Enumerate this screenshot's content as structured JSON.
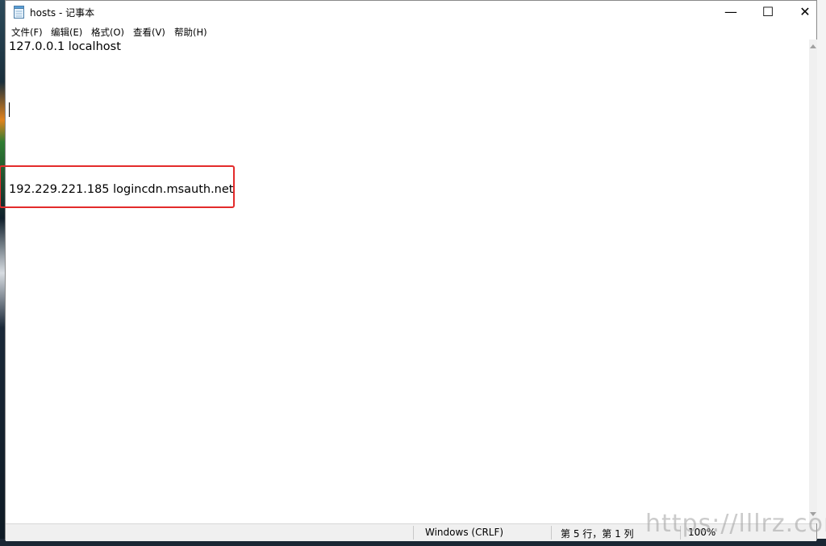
{
  "window": {
    "title": "hosts - 记事本",
    "minimize_glyph": "—",
    "maximize_glyph": "☐",
    "close_glyph": "✕"
  },
  "menu": {
    "items": [
      "文件(F)",
      "编辑(E)",
      "格式(O)",
      "查看(V)",
      "帮助(H)"
    ]
  },
  "editor": {
    "lines": [
      "127.0.0.1 localhost",
      "192.229.221.185 logincdn.msauth.net"
    ]
  },
  "status": {
    "encoding": "Windows (CRLF)",
    "position": "第 5 行，第 1 列",
    "zoom": "100%"
  },
  "watermark": "https://lllrz.com",
  "colors": {
    "highlight_border": "#e32b2b"
  }
}
